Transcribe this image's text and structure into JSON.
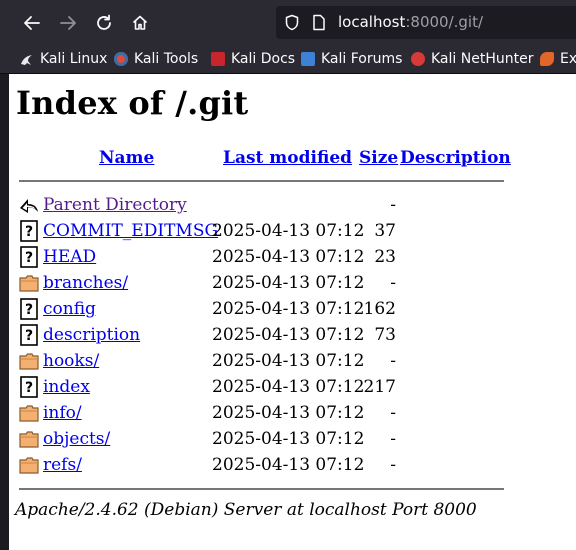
{
  "browser": {
    "url_host": "localhost",
    "url_rest": ":8000/.git/",
    "bookmarks": [
      {
        "label": "Kali Linux",
        "icon": "kali-dragon-icon",
        "color": "#3b6ea8"
      },
      {
        "label": "Kali Tools",
        "icon": "kali-tools-icon",
        "color": "#e04a3c"
      },
      {
        "label": "Kali Docs",
        "icon": "kali-docs-icon",
        "color": "#c8252c"
      },
      {
        "label": "Kali Forums",
        "icon": "kali-forums-icon",
        "color": "#3e82d6"
      },
      {
        "label": "Kali NetHunter",
        "icon": "nethunter-icon",
        "color": "#d83a3a"
      },
      {
        "label": "Ex",
        "icon": "exploit-db-icon",
        "color": "#e0662a"
      }
    ]
  },
  "page": {
    "title": "Index of /.git",
    "columns": {
      "name": "Name",
      "modified": "Last modified",
      "size": "Size",
      "description": "Description"
    },
    "rows": [
      {
        "name": "Parent Directory",
        "modified": "",
        "size": "-",
        "icon": "parent-directory-icon",
        "visited": true
      },
      {
        "name": "COMMIT_EDITMSG",
        "modified": "2025-04-13 07:12",
        "size": "37",
        "icon": "file-icon"
      },
      {
        "name": "HEAD",
        "modified": "2025-04-13 07:12",
        "size": "23",
        "icon": "file-icon"
      },
      {
        "name": "branches/",
        "modified": "2025-04-13 07:12",
        "size": "-",
        "icon": "folder-icon"
      },
      {
        "name": "config",
        "modified": "2025-04-13 07:12",
        "size": "162",
        "icon": "file-icon"
      },
      {
        "name": "description",
        "modified": "2025-04-13 07:12",
        "size": "73",
        "icon": "file-icon"
      },
      {
        "name": "hooks/",
        "modified": "2025-04-13 07:12",
        "size": "-",
        "icon": "folder-icon"
      },
      {
        "name": "index",
        "modified": "2025-04-13 07:12",
        "size": "217",
        "icon": "file-icon"
      },
      {
        "name": "info/",
        "modified": "2025-04-13 07:12",
        "size": "-",
        "icon": "folder-icon"
      },
      {
        "name": "objects/",
        "modified": "2025-04-13 07:12",
        "size": "-",
        "icon": "folder-icon"
      },
      {
        "name": "refs/",
        "modified": "2025-04-13 07:12",
        "size": "-",
        "icon": "folder-icon"
      }
    ],
    "footer": "Apache/2.4.62 (Debian) Server at localhost Port 8000"
  }
}
